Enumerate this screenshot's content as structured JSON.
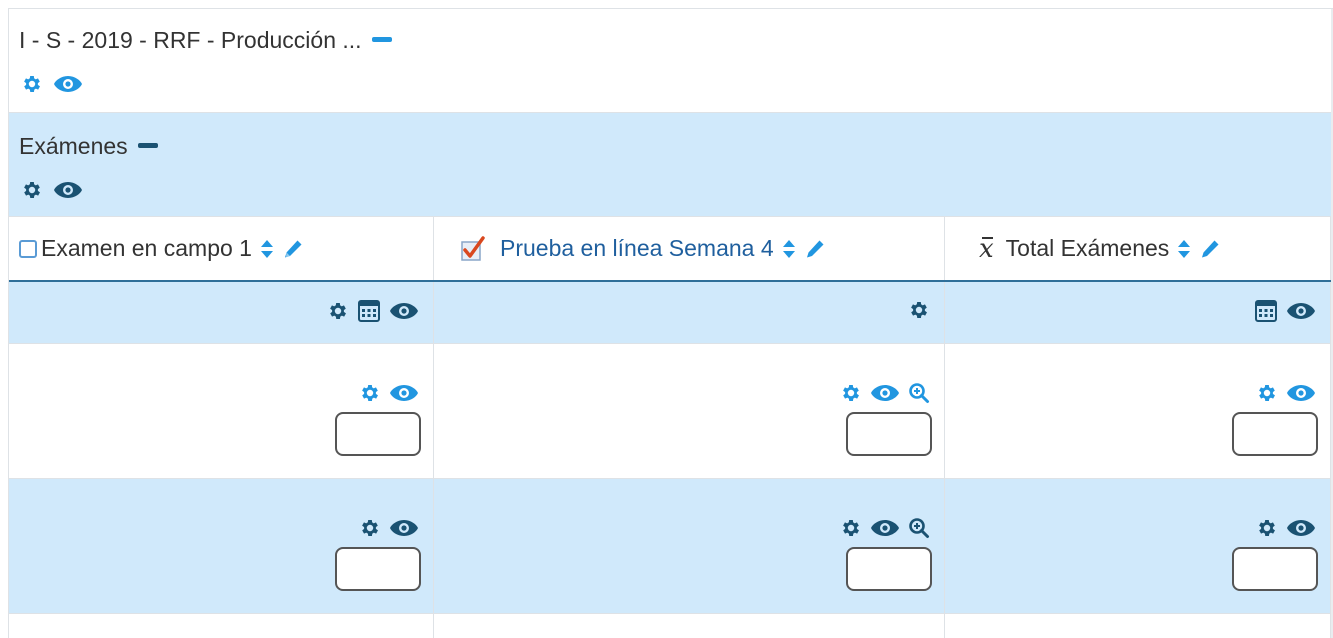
{
  "category": {
    "title": "I - S - 2019 - RRF - Producción ...",
    "accent_color": "#2196e0"
  },
  "subcategory": {
    "title": "Exámenes",
    "accent_color": "#1a5272"
  },
  "columns": [
    {
      "name": "Examen en campo 1",
      "type_icon": "checkbox-icon",
      "header_icons": [
        "gear-icon",
        "calculator-icon",
        "eye-icon"
      ]
    },
    {
      "name": "Prueba en línea Semana 4",
      "type_icon": "quiz-checkbox-icon",
      "header_icons": [
        "gear-icon"
      ]
    },
    {
      "name": "Total Exámenes",
      "type_icon": "mean-xbar-icon",
      "header_icons": [
        "calculator-icon",
        "eye-icon"
      ]
    }
  ],
  "rows": [
    {
      "background": "#ffffff",
      "cells": [
        {
          "value": ""
        },
        {
          "value": ""
        },
        {
          "value": ""
        }
      ]
    },
    {
      "background": "#d0e9fb",
      "cells": [
        {
          "value": ""
        },
        {
          "value": ""
        },
        {
          "value": ""
        }
      ]
    }
  ],
  "colors": {
    "light_blue_row": "#d0e9fb",
    "icon_blue": "#2196e0",
    "icon_dark": "#1a5272",
    "link_blue": "#1f5f9e"
  }
}
